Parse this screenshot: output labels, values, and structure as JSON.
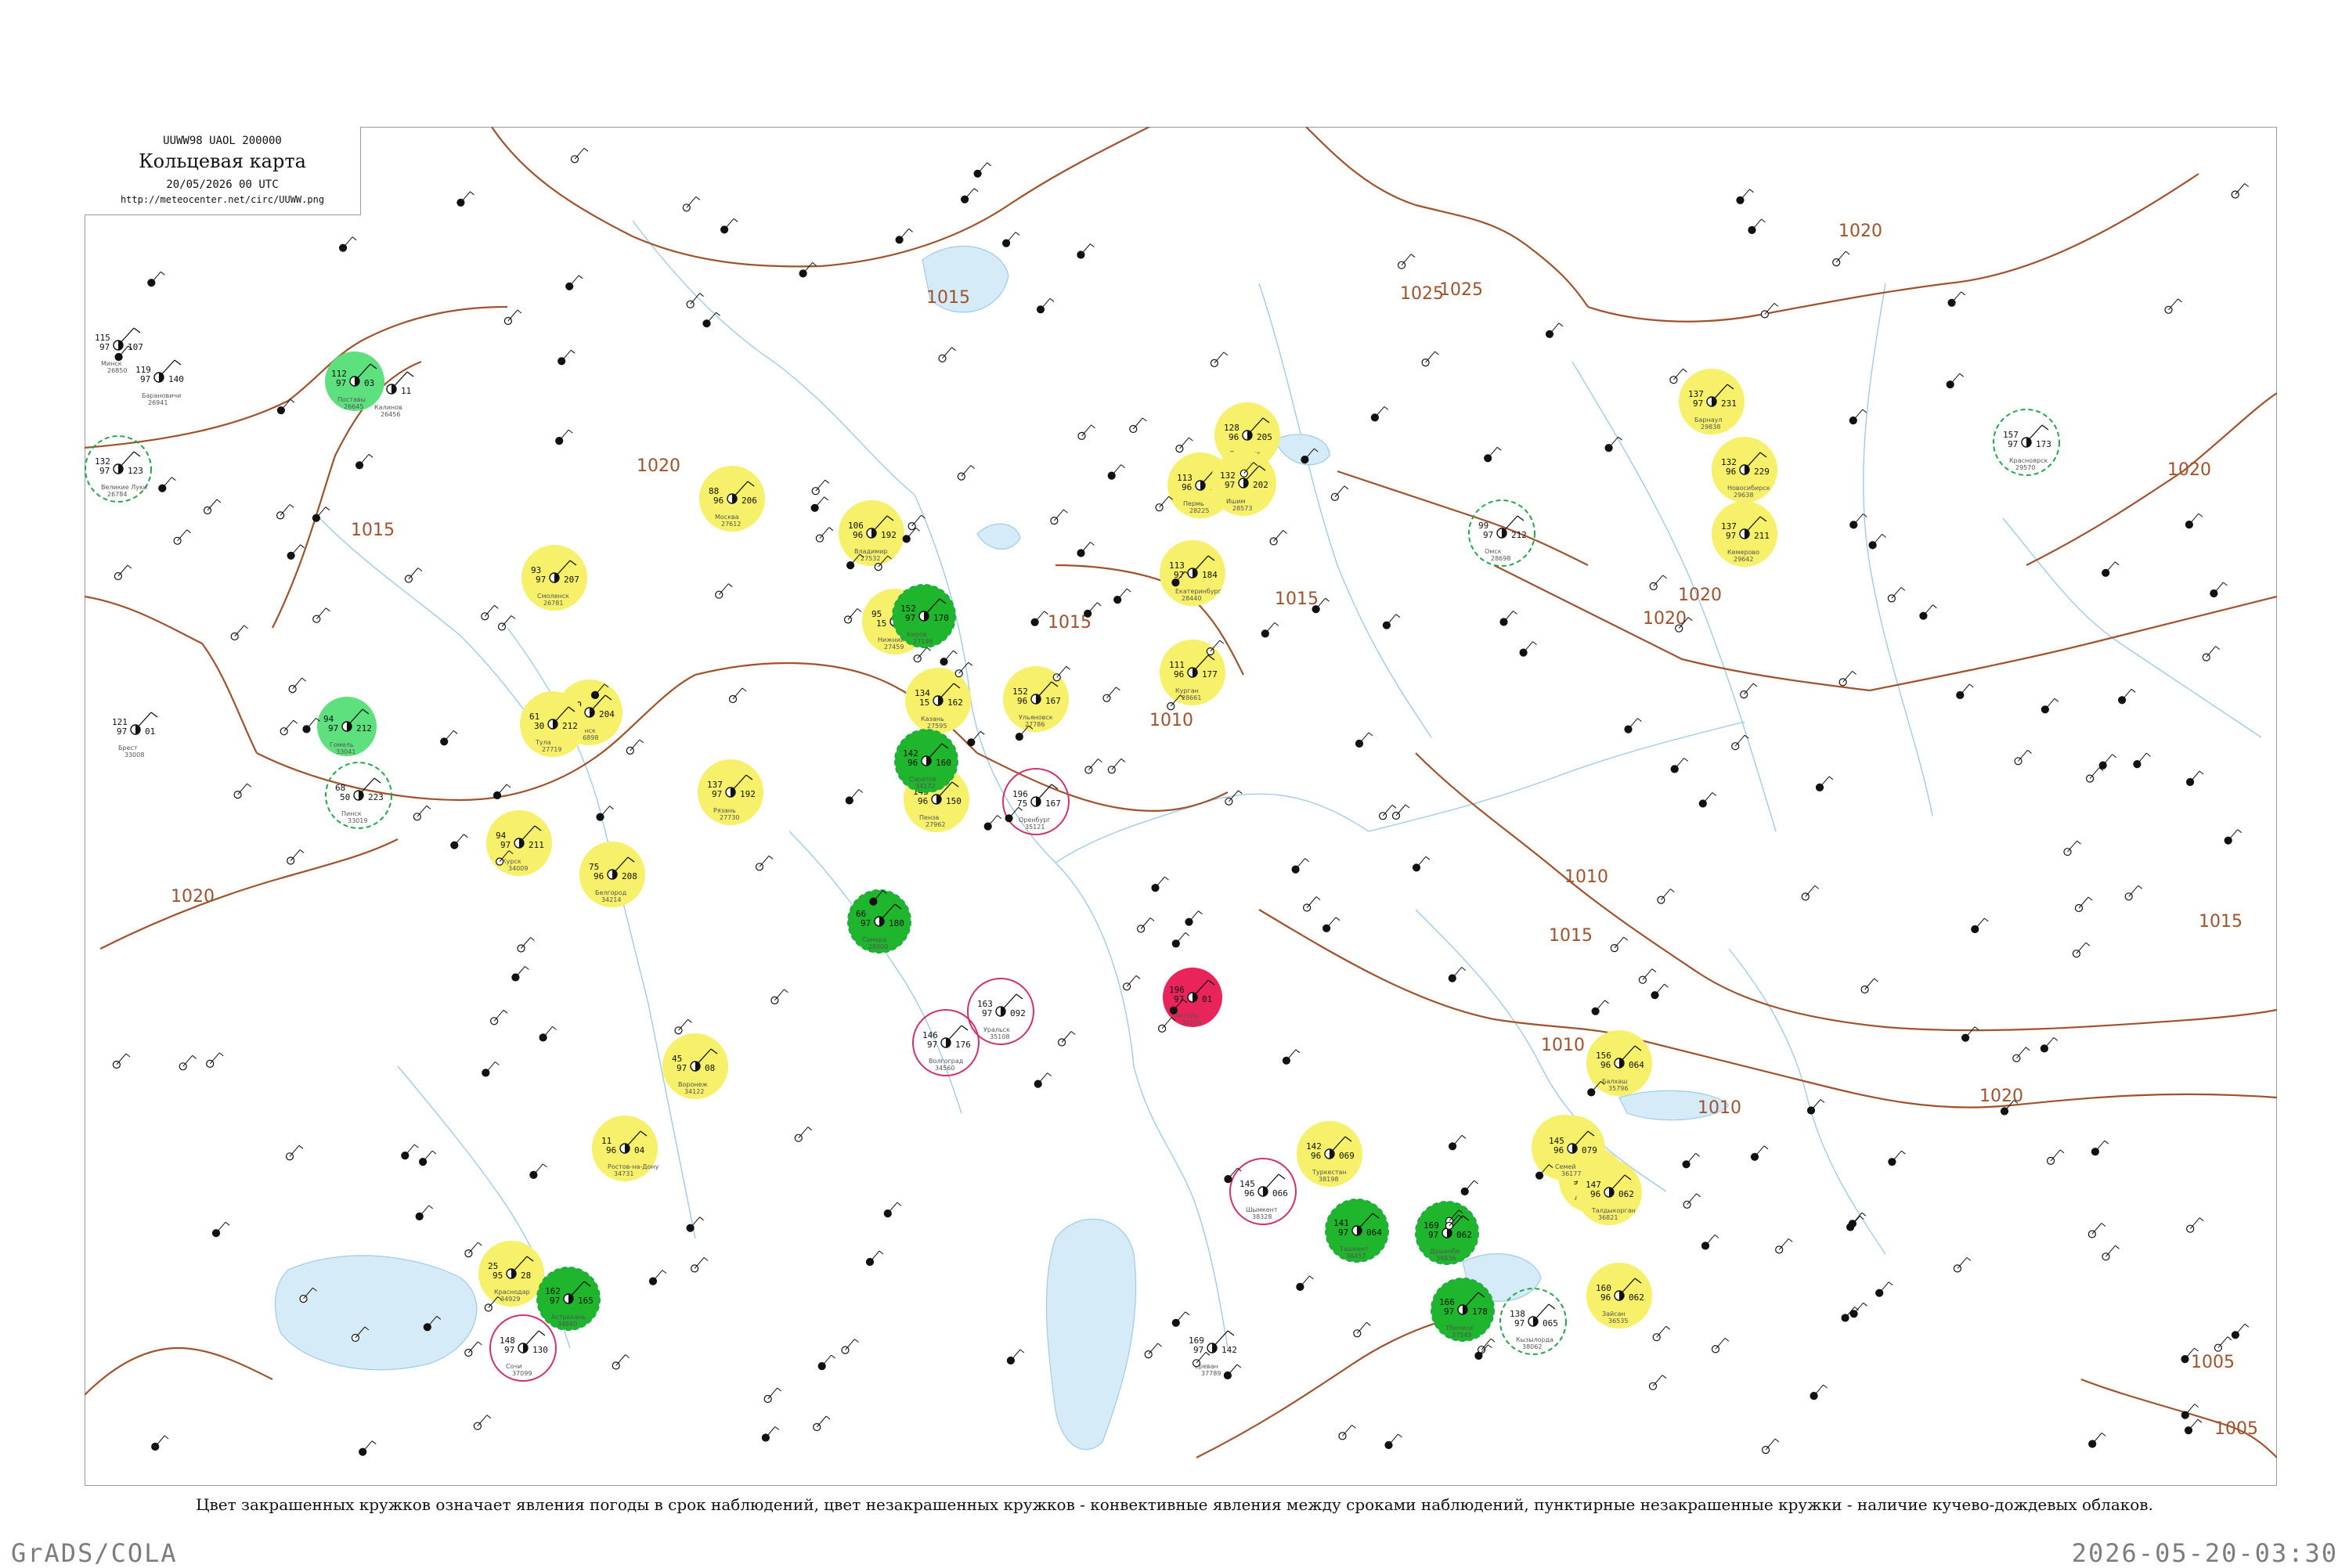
{
  "header": {
    "code_line": "UUWW98  UAOL  200000",
    "title": "Кольцевая карта",
    "date_line": "20/05/2026 00 UTC",
    "url": "http://meteocenter.net/circ/UUWW.png"
  },
  "caption": "Цвет закрашенных кружков означает явления погоды в срок наблюдений, цвет незакрашенных кружков - конвективные явления между сроками наблюдений, пунктирные незакрашенные кружки - наличие кучево-дождевых облаков.",
  "footer": {
    "left": "GrADS/COLA",
    "right": "2026-05-20-03:30"
  },
  "colors": {
    "isobar": "#a0522d",
    "water": "#9fcbea",
    "rain_yellow": "#f7f06a",
    "thunder_green": "#1fb52c",
    "light_green": "#5fe07e",
    "hail_red": "#e8245a",
    "ring_green": "#22a84a",
    "ring_magenta": "#d0306e"
  },
  "isobar_labels": [
    "1015",
    "1020",
    "1025",
    "1020",
    "1025",
    "1015",
    "1015",
    "1020",
    "1020",
    "1015",
    "1015",
    "1010",
    "1010",
    "1010",
    "1015",
    "1005",
    "1005",
    "1020",
    "1020",
    "1020",
    "1010"
  ],
  "stations": [
    {
      "name": "Калинов",
      "id": "26456",
      "p": "127",
      "t": "97",
      "dp": "11",
      "style": "none"
    },
    {
      "name": "Великие Луки",
      "id": "26784",
      "p": "132",
      "t": "97",
      "dp": "123",
      "style": "ring-green"
    },
    {
      "name": "Минск",
      "id": "26850",
      "p": "115",
      "t": "97",
      "dp": "107",
      "style": "none"
    },
    {
      "name": "Барановичи",
      "id": "26941",
      "p": "119",
      "t": "97",
      "dp": "140",
      "style": "none"
    },
    {
      "name": "Поставы",
      "id": "26645",
      "p": "112",
      "t": "97",
      "dp": "03",
      "style": "light-green"
    },
    {
      "name": "Брест",
      "id": "33008",
      "p": "121",
      "t": "97",
      "dp": "01",
      "style": "none"
    },
    {
      "name": "Пинск",
      "id": "33019",
      "p": "68",
      "t": "50",
      "dp": "223",
      "style": "ring-green"
    },
    {
      "name": "Гомель",
      "id": "33041",
      "p": "94",
      "t": "97",
      "dp": "212",
      "style": "light-green"
    },
    {
      "name": "Смоленск",
      "id": "26781",
      "p": "93",
      "t": "97",
      "dp": "207",
      "style": "yellow"
    },
    {
      "name": "Брянск",
      "id": "26898",
      "p": "100",
      "t": "97",
      "dp": "204",
      "style": "yellow"
    },
    {
      "name": "Курск",
      "id": "34009",
      "p": "94",
      "t": "97",
      "dp": "211",
      "style": "yellow"
    },
    {
      "name": "Белгород",
      "id": "34214",
      "p": "75",
      "t": "96",
      "dp": "208",
      "style": "yellow"
    },
    {
      "name": "Москва",
      "id": "27612",
      "p": "88",
      "t": "96",
      "dp": "206",
      "style": "yellow"
    },
    {
      "name": "Тула",
      "id": "27719",
      "p": "61",
      "t": "30",
      "dp": "212",
      "style": "yellow"
    },
    {
      "name": "Рязань",
      "id": "27730",
      "p": "137",
      "t": "97",
      "dp": "192",
      "style": "yellow"
    },
    {
      "name": "Владимир",
      "id": "27532",
      "p": "106",
      "t": "96",
      "dp": "192",
      "style": "yellow"
    },
    {
      "name": "Нижний Новгород",
      "id": "27459",
      "p": "95",
      "t": "15",
      "dp": "200",
      "style": "yellow"
    },
    {
      "name": "Киров",
      "id": "27196",
      "p": "152",
      "t": "97",
      "dp": "170",
      "style": "thunder-green"
    },
    {
      "name": "Казань",
      "id": "27595",
      "p": "134",
      "t": "15",
      "dp": "162",
      "style": "yellow"
    },
    {
      "name": "Пенза",
      "id": "27962",
      "p": "143",
      "t": "96",
      "dp": "150",
      "style": "yellow"
    },
    {
      "name": "Ульяновск",
      "id": "27786",
      "p": "152",
      "t": "96",
      "dp": "167",
      "style": "yellow"
    },
    {
      "name": "Самара",
      "id": "28900",
      "p": "66",
      "t": "97",
      "dp": "180",
      "style": "thunder-green"
    },
    {
      "name": "Саратов",
      "id": "34172",
      "p": "142",
      "t": "96",
      "dp": "160",
      "style": "thunder-green"
    },
    {
      "name": "Оренбург",
      "id": "35121",
      "p": "196",
      "t": "75",
      "dp": "167",
      "style": "ring-magenta"
    },
    {
      "name": "Уральск",
      "id": "35108",
      "p": "163",
      "t": "97",
      "dp": "092",
      "style": "ring-magenta"
    },
    {
      "name": "Актобе",
      "id": "35229",
      "p": "196",
      "t": "97",
      "dp": "01",
      "style": "hail-red"
    },
    {
      "name": "Воронеж",
      "id": "34122",
      "p": "45",
      "t": "97",
      "dp": "08",
      "style": "yellow"
    },
    {
      "name": "Ростов-на-Дону",
      "id": "34731",
      "p": "11",
      "t": "96",
      "dp": "04",
      "style": "yellow"
    },
    {
      "name": "Краснодар",
      "id": "34929",
      "p": "25",
      "t": "95",
      "dp": "28",
      "style": "yellow"
    },
    {
      "name": "Астрахань",
      "id": "34880",
      "p": "162",
      "t": "97",
      "dp": "165",
      "style": "thunder-green"
    },
    {
      "name": "Волгоград",
      "id": "34560",
      "p": "146",
      "t": "97",
      "dp": "176",
      "style": "ring-magenta"
    },
    {
      "name": "Пермь",
      "id": "28225",
      "p": "113",
      "t": "96",
      "dp": "196",
      "style": "yellow"
    },
    {
      "name": "Екатеринбург",
      "id": "28440",
      "p": "113",
      "t": "97",
      "dp": "184",
      "style": "yellow"
    },
    {
      "name": "Тобольск",
      "id": "28275",
      "p": "128",
      "t": "96",
      "dp": "205",
      "style": "yellow"
    },
    {
      "name": "Ишим",
      "id": "28573",
      "p": "132",
      "t": "97",
      "dp": "202",
      "style": "yellow"
    },
    {
      "name": "Курган",
      "id": "28661",
      "p": "111",
      "t": "96",
      "dp": "177",
      "style": "yellow"
    },
    {
      "name": "Омск",
      "id": "28698",
      "p": "99",
      "t": "97",
      "dp": "212",
      "style": "ring-green"
    },
    {
      "name": "Барнаул",
      "id": "29838",
      "p": "137",
      "t": "97",
      "dp": "231",
      "style": "yellow"
    },
    {
      "name": "Новосибирск",
      "id": "29638",
      "p": "132",
      "t": "96",
      "dp": "229",
      "style": "yellow"
    },
    {
      "name": "Кемерово",
      "id": "29642",
      "p": "137",
      "t": "97",
      "dp": "211",
      "style": "yellow"
    },
    {
      "name": "Красноярск",
      "id": "29570",
      "p": "157",
      "t": "97",
      "dp": "173",
      "style": "ring-green"
    },
    {
      "name": "Туркестан",
      "id": "38198",
      "p": "142",
      "t": "96",
      "dp": "069",
      "style": "yellow"
    },
    {
      "name": "Шымкент",
      "id": "38328",
      "p": "145",
      "t": "96",
      "dp": "066",
      "style": "ring-magenta"
    },
    {
      "name": "Ташкент",
      "id": "38457",
      "p": "141",
      "t": "97",
      "dp": "064",
      "style": "thunder-green"
    },
    {
      "name": "Бишкек",
      "id": "38353",
      "p": "156",
      "t": "96",
      "dp": "063",
      "style": "yellow"
    },
    {
      "name": "Алматы",
      "id": "36870",
      "p": "152",
      "t": "96",
      "dp": "062",
      "style": "yellow"
    },
    {
      "name": "Талдыкорган",
      "id": "36821",
      "p": "147",
      "t": "96",
      "dp": "062",
      "style": "yellow"
    },
    {
      "name": "Балхаш",
      "id": "35796",
      "p": "156",
      "t": "96",
      "dp": "064",
      "style": "yellow"
    },
    {
      "name": "Семей",
      "id": "36177",
      "p": "145",
      "t": "96",
      "dp": "079",
      "style": "yellow"
    },
    {
      "name": "Зайсан",
      "id": "36535",
      "p": "160",
      "t": "96",
      "dp": "062",
      "style": "yellow"
    },
    {
      "name": "Душанбе",
      "id": "38836",
      "p": "169",
      "t": "97",
      "dp": "062",
      "style": "thunder-green"
    },
    {
      "name": "Кызылорда",
      "id": "38062",
      "p": "138",
      "t": "97",
      "dp": "065",
      "style": "ring-green"
    },
    {
      "name": "Сочи",
      "id": "37099",
      "p": "148",
      "t": "97",
      "dp": "130",
      "style": "ring-magenta"
    },
    {
      "name": "Тбилиси",
      "id": "37549",
      "p": "166",
      "t": "97",
      "dp": "178",
      "style": "thunder-green"
    },
    {
      "name": "Ереван",
      "id": "37789",
      "p": "169",
      "t": "97",
      "dp": "142",
      "style": "none"
    }
  ]
}
